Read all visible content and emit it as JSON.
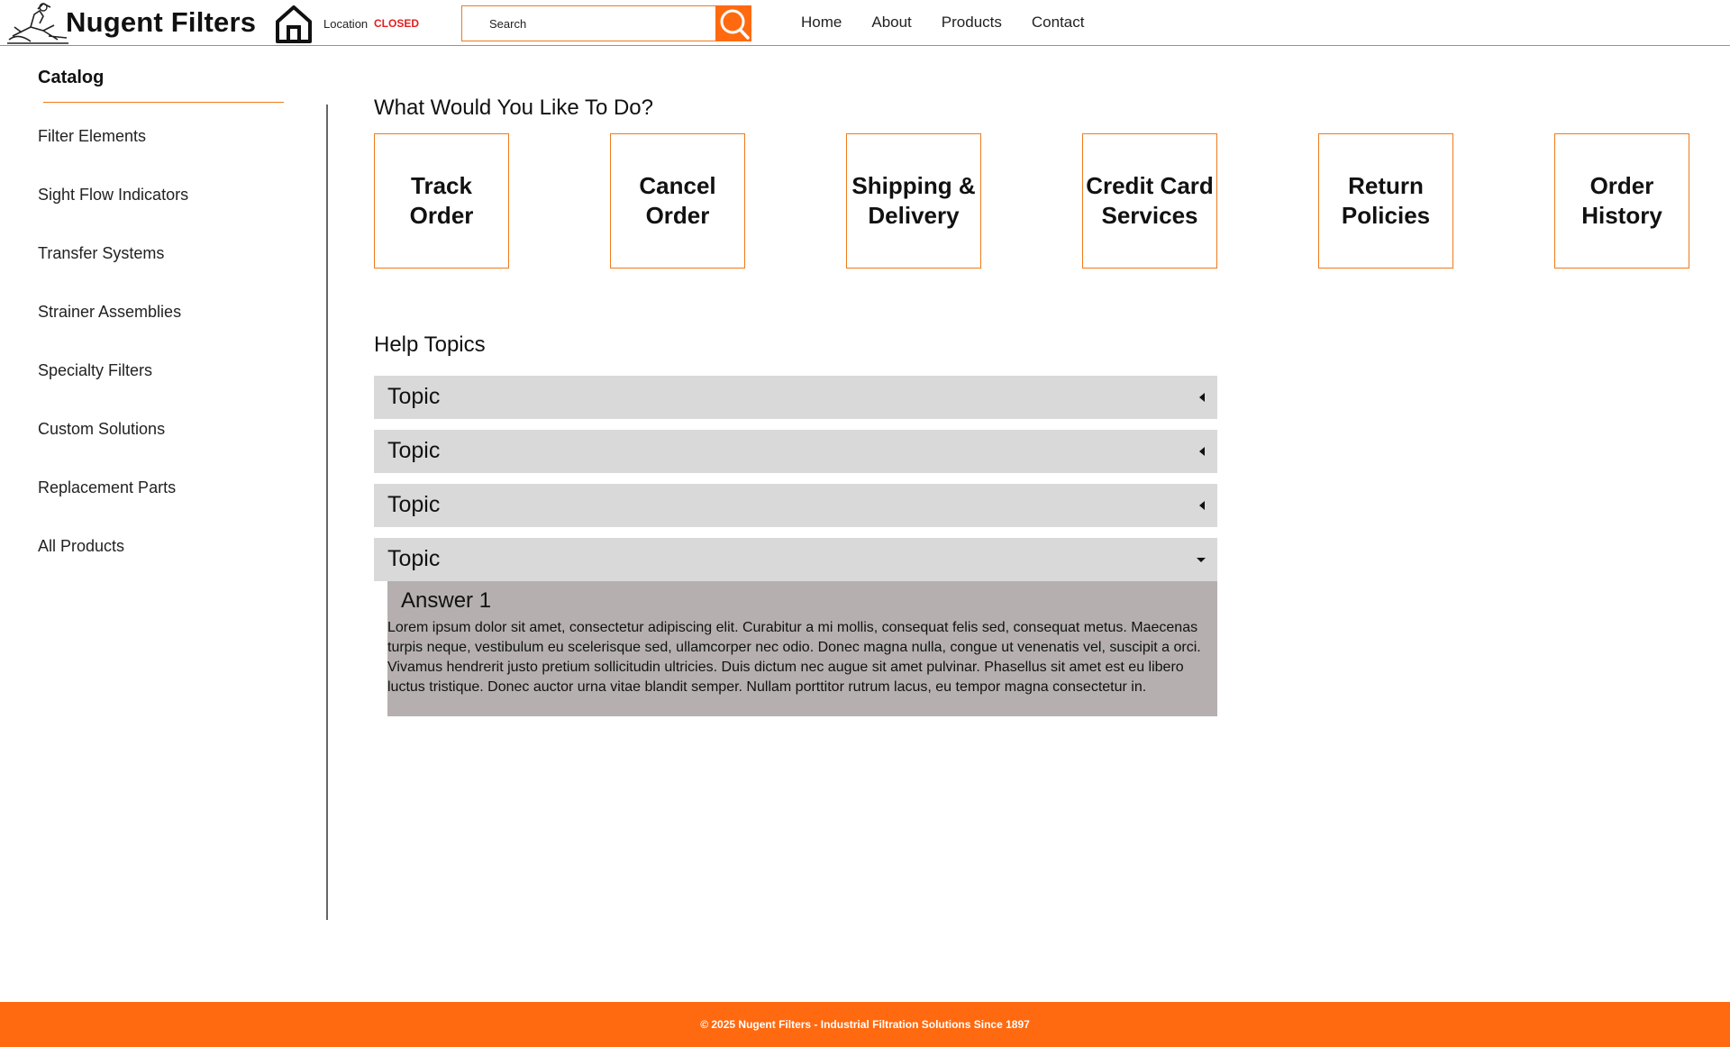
{
  "header": {
    "brand": "Nugent Filters",
    "location_label": "Location",
    "location_status": "CLOSED",
    "search_placeholder": "Search",
    "nav": [
      "Home",
      "About",
      "Products",
      "Contact"
    ],
    "icons": {
      "logo": "mascot-logo",
      "home": "home-icon",
      "search": "search-icon"
    }
  },
  "sidebar": {
    "title": "Catalog",
    "items": [
      "Filter Elements",
      "Sight Flow Indicators",
      "Transfer Systems",
      "Strainer Assemblies",
      "Specialty Filters",
      "Custom Solutions",
      "Replacement Parts",
      "All Products"
    ]
  },
  "main": {
    "actions_heading": "What Would You Like To Do?",
    "actions": [
      "Track\nOrder",
      "Cancel\nOrder",
      "Shipping &\nDelivery",
      "Credit Card\nServices",
      "Return\nPolicies",
      "Order\nHistory"
    ],
    "help_heading": "Help Topics",
    "topics": [
      {
        "label": "Topic",
        "expanded": false
      },
      {
        "label": "Topic",
        "expanded": false
      },
      {
        "label": "Topic",
        "expanded": false
      },
      {
        "label": "Topic",
        "expanded": true
      }
    ],
    "answer": {
      "title": "Answer 1",
      "body": "Lorem ipsum dolor sit amet, consectetur adipiscing elit. Curabitur a mi mollis, consequat felis sed, consequat metus. Maecenas turpis neque, vestibulum eu scelerisque sed, ullamcorper nec odio. Donec magna nulla, congue ut venenatis vel, suscipit a orci. Vivamus hendrerit justo pretium sollicitudin ultricies. Duis dictum nec augue sit amet pulvinar. Phasellus sit amet est eu libero luctus tristique. Donec auctor urna vitae blandit semper. Nullam porttitor rutrum lacus, eu tempor magna consectetur in."
    }
  },
  "footer": {
    "text": "© 2025 Nugent Filters - Industrial Filtration Solutions Since 1897"
  },
  "colors": {
    "accent": "#ff6a10",
    "border_accent": "#f07a1a",
    "status_closed": "#e02020",
    "topic_bg": "#d9d9d9",
    "answer_bg": "#b5b0af"
  }
}
